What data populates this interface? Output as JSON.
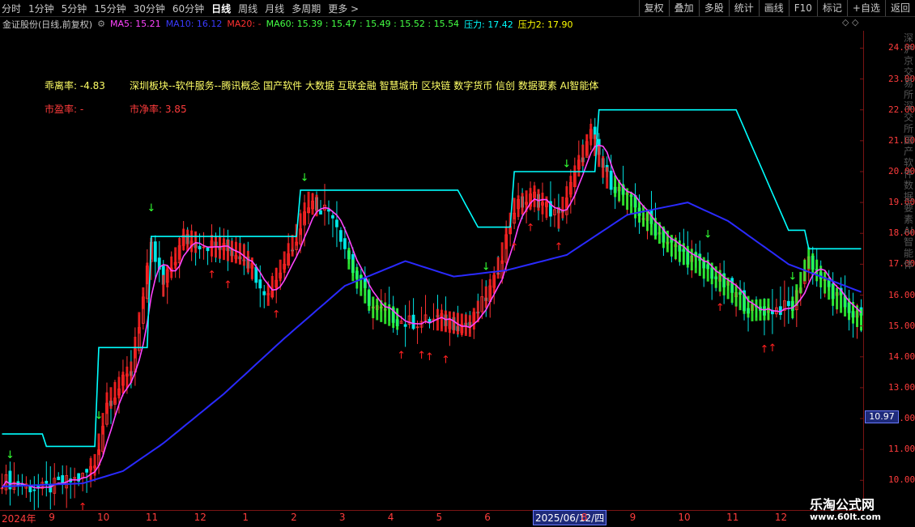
{
  "periods": [
    "分时",
    "1分钟",
    "5分钟",
    "15分钟",
    "30分钟",
    "60分钟",
    "日线",
    "周线",
    "月线",
    "多周期",
    "更多 >"
  ],
  "active_period": "日线",
  "tools": [
    "复权",
    "叠加",
    "多股",
    "统计",
    "画线",
    "F10",
    "标记",
    "+自选",
    "返回"
  ],
  "stock_title": "金证股份(日线,前复权)",
  "ma_labels": {
    "ma5": "MA5: 15.21",
    "ma10": "MA10: 16.12",
    "ma20": "MA20: -",
    "ma60": "MA60: 15.39 : 15.47 : 15.49 : 15.52 : 15.54",
    "p1": "压力: 17.42",
    "p2": "压力2: 17.90"
  },
  "colors": {
    "ma5": "#ff44ff",
    "ma10": "#2a2aff",
    "ma20": "#ff3030",
    "ma60": "#44ff44",
    "pressure": "#00ffff",
    "pressure2": "#ffff00"
  },
  "info": {
    "deviation": "乖离率: -4.83",
    "sector": "深圳板块--软件服务--腾讯概念 国产软件 大数据 互联金融 智慧城市 区块链 数字货币 信创 数据要素 AI智能体",
    "pe": "市盈率: -",
    "pb": "市净率: 3.85"
  },
  "current_price": "10.97",
  "side_text": "深沪京交易所深交所国产软件数据要素AI智能体",
  "watermark": {
    "name": "乐淘公式网",
    "url": "www.60lt.com"
  },
  "chart_data": {
    "type": "candlestick",
    "ylim": [
      9.3,
      24.3
    ],
    "yticks": [
      "24.00",
      "23.00",
      "22.00",
      "21.00",
      "20.00",
      "19.00",
      "18.00",
      "17.00",
      "16.00",
      "15.00",
      "14.00",
      "13.00",
      "12.00",
      "11.00",
      "10.00"
    ],
    "xticks": [
      "2024年",
      "9",
      "10",
      "11",
      "12",
      "1",
      "2",
      "3",
      "4",
      "5",
      "6",
      "2025/06/12/四",
      "8",
      "9",
      "10",
      "11",
      "12"
    ],
    "xtick_index": [
      0,
      12,
      24,
      36,
      48,
      60,
      72,
      84,
      96,
      108,
      120,
      132,
      144,
      156,
      168,
      180,
      192
    ],
    "n_bars": 214,
    "close_anchors": [
      [
        0,
        10.0
      ],
      [
        10,
        9.7
      ],
      [
        20,
        10.1
      ],
      [
        23,
        10.5
      ],
      [
        26,
        12.5
      ],
      [
        32,
        13.5
      ],
      [
        37,
        17.5
      ],
      [
        40,
        16.3
      ],
      [
        45,
        17.8
      ],
      [
        52,
        17.6
      ],
      [
        60,
        17.3
      ],
      [
        66,
        16.0
      ],
      [
        72,
        17.6
      ],
      [
        76,
        19.0
      ],
      [
        82,
        18.7
      ],
      [
        87,
        16.8
      ],
      [
        92,
        15.6
      ],
      [
        100,
        15.1
      ],
      [
        108,
        15.2
      ],
      [
        116,
        15.0
      ],
      [
        122,
        16.4
      ],
      [
        127,
        18.8
      ],
      [
        132,
        19.2
      ],
      [
        138,
        18.5
      ],
      [
        146,
        21.2
      ],
      [
        150,
        19.8
      ],
      [
        158,
        18.7
      ],
      [
        166,
        17.6
      ],
      [
        176,
        16.7
      ],
      [
        186,
        15.5
      ],
      [
        196,
        15.6
      ],
      [
        200,
        17.2
      ],
      [
        206,
        16.0
      ],
      [
        213,
        15.2
      ]
    ],
    "ma_slow_anchors": [
      [
        0,
        9.8
      ],
      [
        20,
        9.9
      ],
      [
        30,
        10.3
      ],
      [
        40,
        11.2
      ],
      [
        55,
        12.8
      ],
      [
        70,
        14.6
      ],
      [
        85,
        16.3
      ],
      [
        100,
        17.1
      ],
      [
        112,
        16.6
      ],
      [
        125,
        16.8
      ],
      [
        140,
        17.3
      ],
      [
        155,
        18.6
      ],
      [
        170,
        19.0
      ],
      [
        180,
        18.4
      ],
      [
        195,
        17.0
      ],
      [
        213,
        16.1
      ]
    ],
    "pressure_anchors": [
      [
        0,
        11.5
      ],
      [
        10,
        11.5
      ],
      [
        11,
        11.1
      ],
      [
        23,
        11.1
      ],
      [
        24,
        14.3
      ],
      [
        36,
        14.3
      ],
      [
        37,
        17.9
      ],
      [
        73,
        17.9
      ],
      [
        74,
        19.4
      ],
      [
        113,
        19.4
      ],
      [
        118,
        18.2
      ],
      [
        126,
        18.2
      ],
      [
        127,
        20.0
      ],
      [
        147,
        20.0
      ],
      [
        148,
        22.0
      ],
      [
        182,
        22.0
      ],
      [
        195,
        18.1
      ],
      [
        199,
        18.1
      ],
      [
        200,
        17.5
      ],
      [
        213,
        17.5
      ]
    ],
    "buy_arrows": [
      6,
      12,
      17,
      20,
      52,
      56,
      68,
      99,
      104,
      106,
      110,
      127,
      131,
      138,
      178,
      189,
      191
    ],
    "sell_arrows": [
      2,
      24,
      37,
      75,
      120,
      140,
      175,
      196
    ],
    "ribbon_ranges": [
      [
        22,
        37,
        "#ff2020"
      ],
      [
        40,
        48,
        "#ff2020"
      ],
      [
        52,
        62,
        "#ff2020"
      ],
      [
        66,
        78,
        "#ff2020"
      ],
      [
        86,
        98,
        "#33ff33"
      ],
      [
        108,
        118,
        "#ff2020"
      ],
      [
        120,
        135,
        "#ff2020"
      ],
      [
        138,
        150,
        "#ff2020"
      ],
      [
        152,
        190,
        "#33ff33"
      ],
      [
        196,
        213,
        "#33ff33"
      ]
    ]
  }
}
